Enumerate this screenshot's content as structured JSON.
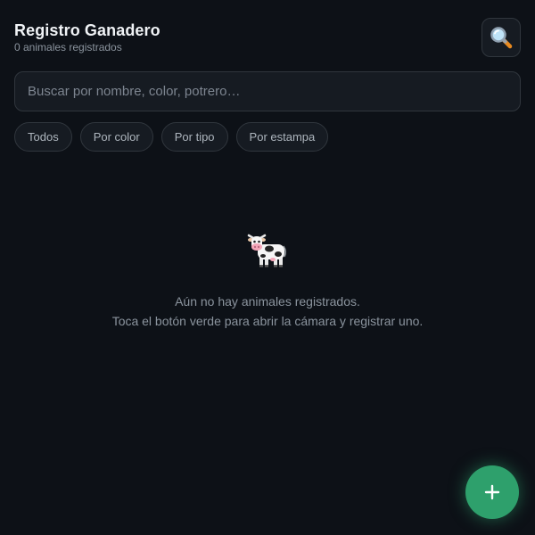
{
  "header": {
    "title": "Registro Ganadero",
    "subtitle": "0 animales registrados",
    "search_icon": "magnifying-glass-icon"
  },
  "search": {
    "placeholder": "Buscar por nombre, color, potrero…",
    "value": ""
  },
  "filters": {
    "items": [
      {
        "label": "Todos"
      },
      {
        "label": "Por color"
      },
      {
        "label": "Por tipo"
      },
      {
        "label": "Por estampa"
      }
    ]
  },
  "empty_state": {
    "icon": "cow-icon",
    "line1": "Aún no hay animales registrados.",
    "line2": "Toca el botón verde para abrir la cámara y registrar uno."
  },
  "fab": {
    "icon": "plus-icon",
    "color": "#2ea06c"
  },
  "colors": {
    "background": "#0d1117",
    "surface": "#161b22",
    "border": "#30363d",
    "accent": "#2ea06c"
  }
}
